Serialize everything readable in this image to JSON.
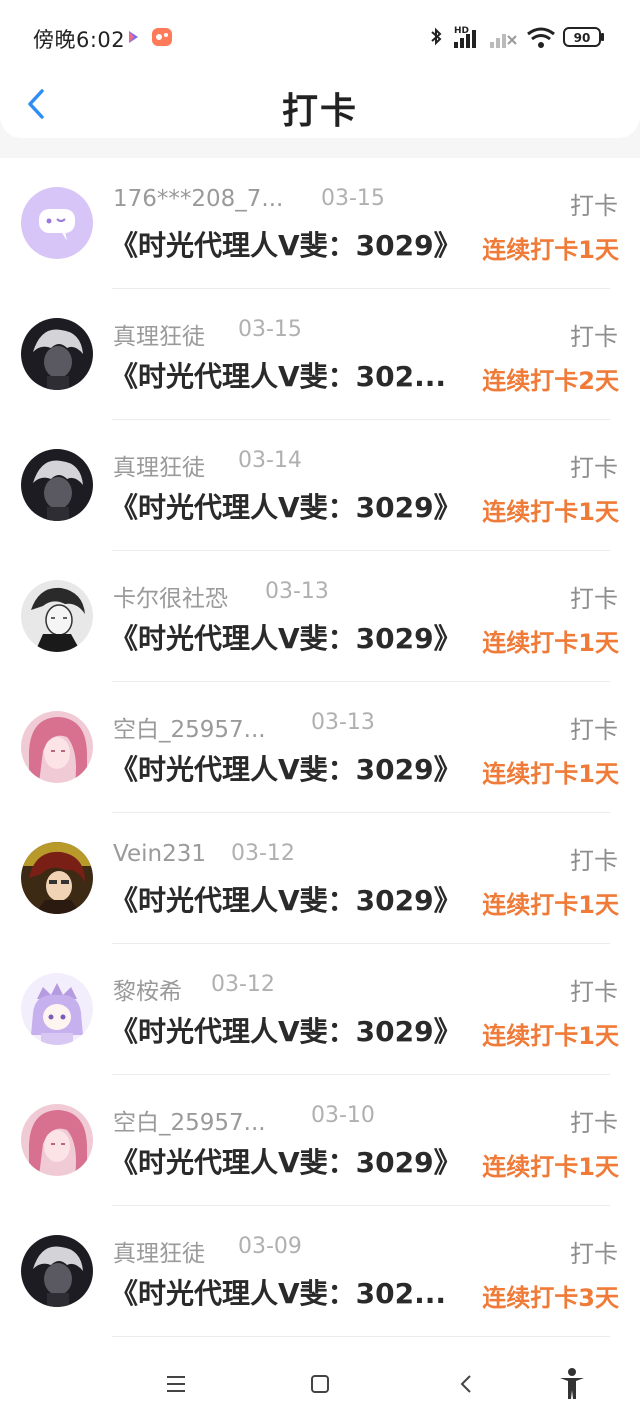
{
  "status_bar": {
    "time": "傍晚6:02",
    "battery": "90",
    "network_label": "HD"
  },
  "header": {
    "title": "打卡",
    "back_icon": "chevron-left-icon"
  },
  "colors": {
    "accent_blue": "#2f8ef5",
    "streak_orange": "#f07b38"
  },
  "checkins": [
    {
      "user": "176***208_7...",
      "date": "03-15",
      "tag": "打卡",
      "book": "《时光代理人V斐：3029》",
      "streak": "连续打卡1天",
      "avatar": "chat-bubble-avatar"
    },
    {
      "user": "真理狂徒",
      "date": "03-15",
      "tag": "打卡",
      "book": "《时光代理人V斐：302...",
      "streak": "连续打卡2天",
      "avatar": "grey-hair-avatar"
    },
    {
      "user": "真理狂徒",
      "date": "03-14",
      "tag": "打卡",
      "book": "《时光代理人V斐：3029》",
      "streak": "连续打卡1天",
      "avatar": "grey-hair-avatar"
    },
    {
      "user": "卡尔很社恐",
      "date": "03-13",
      "tag": "打卡",
      "book": "《时光代理人V斐：3029》",
      "streak": "连续打卡1天",
      "avatar": "sketch-avatar"
    },
    {
      "user": "空白_25957...",
      "date": "03-13",
      "tag": "打卡",
      "book": "《时光代理人V斐：3029》",
      "streak": "连续打卡1天",
      "avatar": "pink-hair-avatar"
    },
    {
      "user": "Vein231",
      "date": "03-12",
      "tag": "打卡",
      "book": "《时光代理人V斐：3029》",
      "streak": "连续打卡1天",
      "avatar": "red-hair-avatar"
    },
    {
      "user": "黎桉希",
      "date": "03-12",
      "tag": "打卡",
      "book": "《时光代理人V斐：3029》",
      "streak": "连续打卡1天",
      "avatar": "purple-crown-avatar"
    },
    {
      "user": "空白_25957...",
      "date": "03-10",
      "tag": "打卡",
      "book": "《时光代理人V斐：3029》",
      "streak": "连续打卡1天",
      "avatar": "pink-hair-avatar"
    },
    {
      "user": "真理狂徒",
      "date": "03-09",
      "tag": "打卡",
      "book": "《时光代理人V斐：302...",
      "streak": "连续打卡3天",
      "avatar": "grey-hair-avatar"
    }
  ],
  "bottom_nav": [
    "menu-icon",
    "home-square-icon",
    "back-chevron-icon",
    "accessibility-icon"
  ]
}
